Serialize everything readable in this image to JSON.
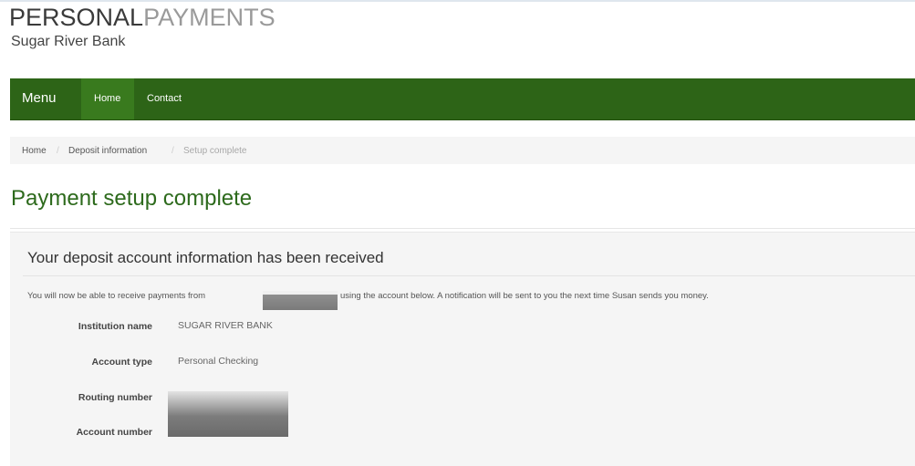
{
  "header": {
    "brand_bold": "PERSONAL",
    "brand_light": "PAYMENTS",
    "bank_name": "Sugar River Bank"
  },
  "nav": {
    "menu_label": "Menu",
    "items": [
      {
        "label": "Home",
        "active": true
      },
      {
        "label": "Contact",
        "active": false
      }
    ]
  },
  "breadcrumb": {
    "items": [
      "Home",
      "Deposit information",
      "Setup complete"
    ],
    "separator": "/"
  },
  "page": {
    "title": "Payment setup complete"
  },
  "panel": {
    "heading": "Your deposit account information has been received",
    "message_part1": "You will now be able to receive payments from",
    "message_part2": "using the account below. A notification will be sent to you the next time Susan sends you money.",
    "fields": [
      {
        "label": "Institution name",
        "value": "SUGAR RIVER BANK"
      },
      {
        "label": "Account type",
        "value": "Personal Checking"
      },
      {
        "label": "Routing number",
        "value": ""
      },
      {
        "label": "Account number",
        "value": ""
      }
    ]
  },
  "colors": {
    "navbar": "#2d6417",
    "nav_active": "#397a1e",
    "title": "#2d6a1c"
  }
}
